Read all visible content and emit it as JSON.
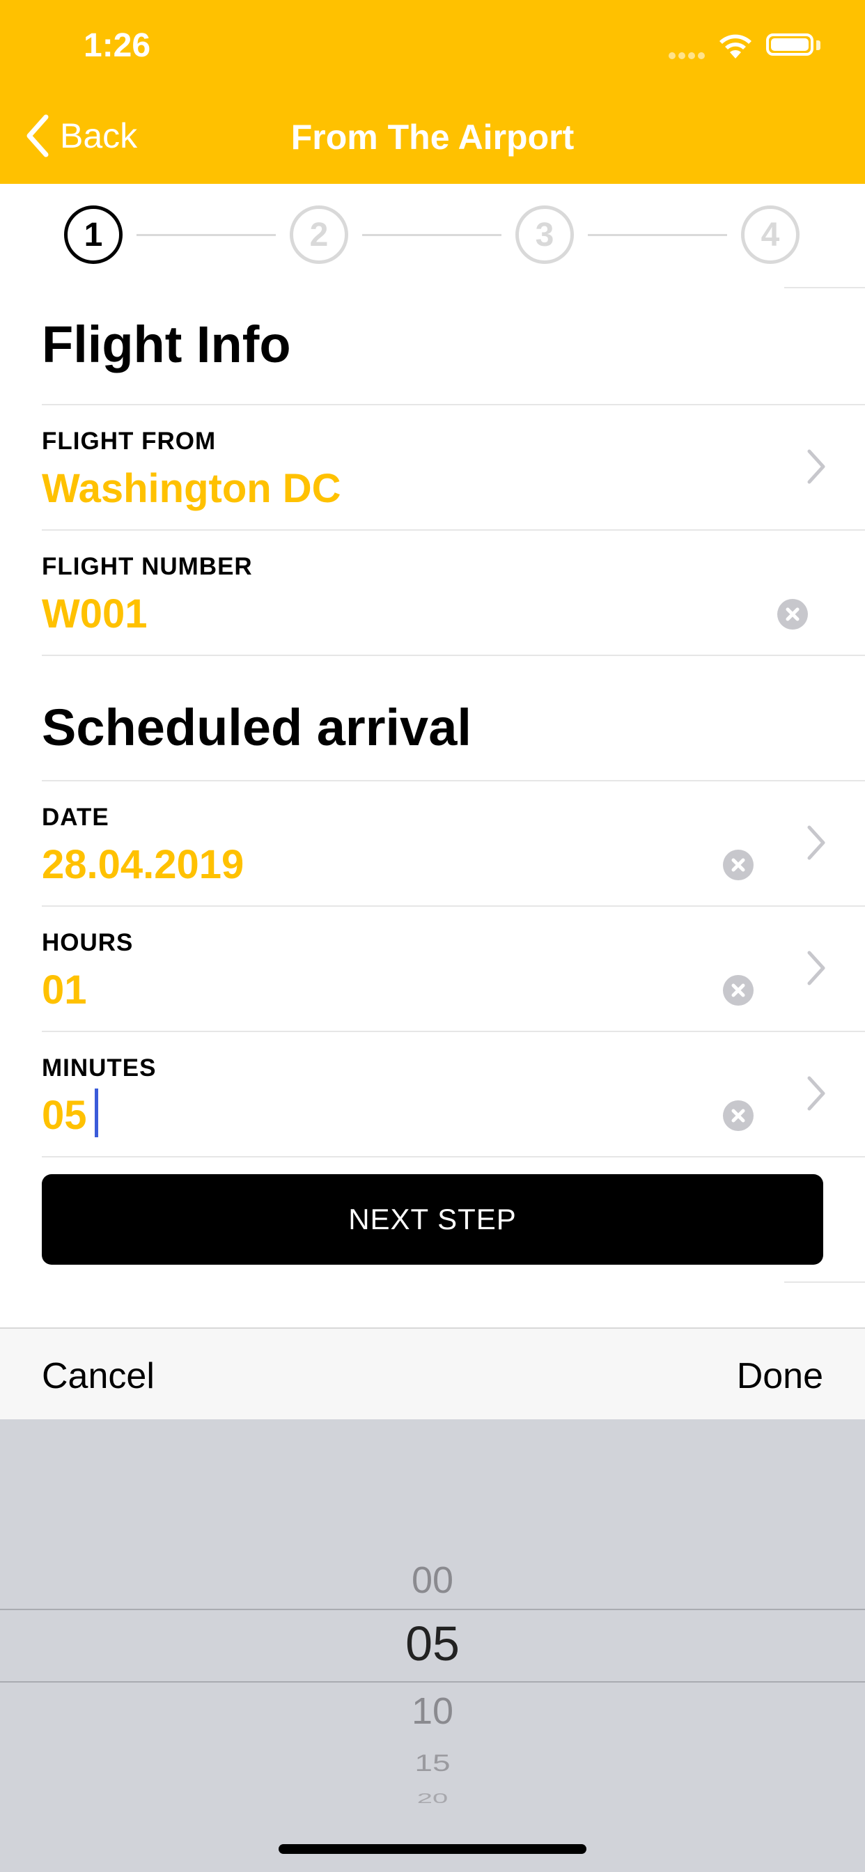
{
  "status_bar": {
    "time": "1:26"
  },
  "nav": {
    "back_label": "Back",
    "title": "From The Airport"
  },
  "stepper": {
    "steps": [
      "1",
      "2",
      "3",
      "4"
    ],
    "active_step": 1
  },
  "flight_info": {
    "title": "Flight Info",
    "flight_from": {
      "label": "FLIGHT FROM",
      "value": "Washington DC"
    },
    "flight_number": {
      "label": "FLIGHT NUMBER",
      "value": "W001"
    }
  },
  "scheduled_arrival": {
    "title": "Scheduled arrival",
    "date": {
      "label": "DATE",
      "value": "28.04.2019"
    },
    "hours": {
      "label": "HOURS",
      "value": "01"
    },
    "minutes": {
      "label": "MINUTES",
      "value": "05"
    }
  },
  "next_step_label": "NEXT STEP",
  "toolbar": {
    "cancel_label": "Cancel",
    "done_label": "Done"
  },
  "picker": {
    "options": [
      "00",
      "05",
      "10",
      "15",
      "20"
    ],
    "selected": "05"
  },
  "colors": {
    "accent": "#FFC100",
    "button": "#000000",
    "picker_bg": "#D1D3D9"
  }
}
